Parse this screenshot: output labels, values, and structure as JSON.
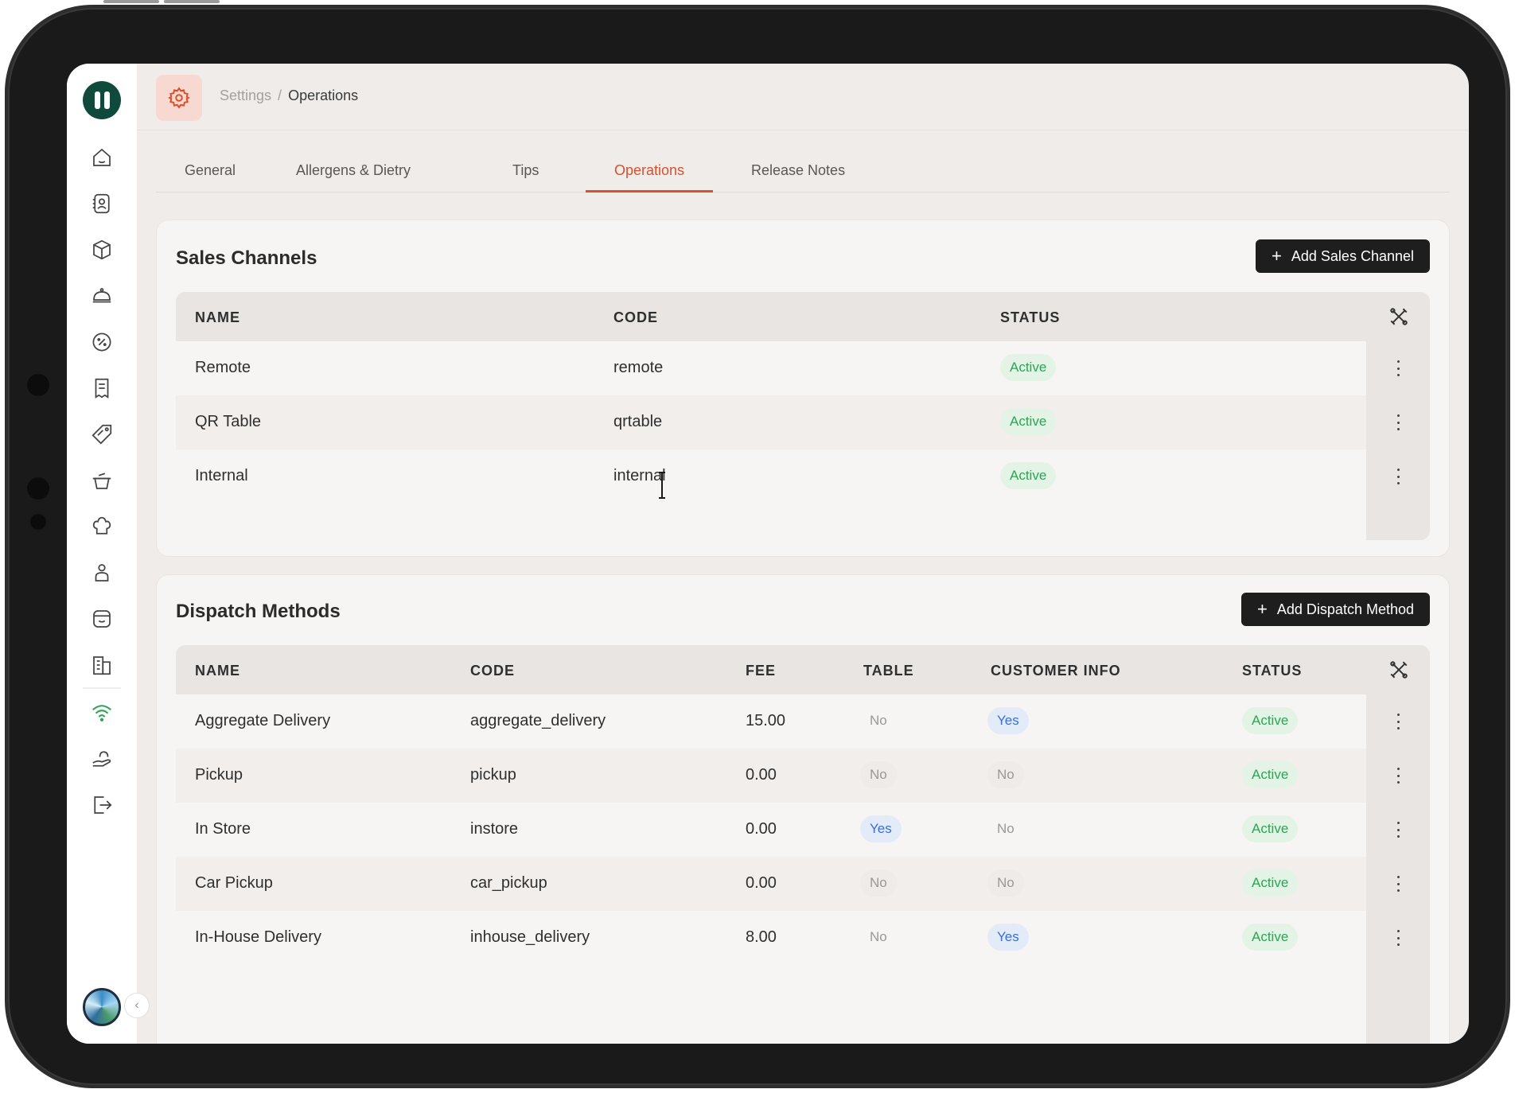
{
  "breadcrumb": {
    "root": "Settings",
    "separator": "/",
    "current": "Operations"
  },
  "tabs": [
    {
      "label": "General"
    },
    {
      "label": "Allergens & Dietry"
    },
    {
      "label": "Tips"
    },
    {
      "label": "Operations",
      "active": true
    },
    {
      "label": "Release Notes"
    }
  ],
  "sales_channels": {
    "title": "Sales Channels",
    "add_label": "Add Sales Channel",
    "columns": [
      "NAME",
      "CODE",
      "STATUS"
    ],
    "rows": [
      {
        "name": "Remote",
        "code": "remote",
        "status": "Active"
      },
      {
        "name": "QR Table",
        "code": "qrtable",
        "status": "Active"
      },
      {
        "name": "Internal",
        "code": "internal",
        "status": "Active"
      }
    ]
  },
  "dispatch_methods": {
    "title": "Dispatch Methods",
    "add_label": "Add Dispatch Method",
    "columns": [
      "NAME",
      "CODE",
      "FEE",
      "TABLE",
      "CUSTOMER INFO",
      "STATUS"
    ],
    "rows": [
      {
        "name": "Aggregate Delivery",
        "code": "aggregate_delivery",
        "fee": "15.00",
        "table": "No",
        "customer_info": "Yes",
        "status": "Active"
      },
      {
        "name": "Pickup",
        "code": "pickup",
        "fee": "0.00",
        "table": "No",
        "customer_info": "No",
        "status": "Active"
      },
      {
        "name": "In Store",
        "code": "instore",
        "fee": "0.00",
        "table": "Yes",
        "customer_info": "No",
        "status": "Active"
      },
      {
        "name": "Car Pickup",
        "code": "car_pickup",
        "fee": "0.00",
        "table": "No",
        "customer_info": "No",
        "status": "Active"
      },
      {
        "name": "In-House Delivery",
        "code": "inhouse_delivery",
        "fee": "8.00",
        "table": "No",
        "customer_info": "Yes",
        "status": "Active"
      }
    ]
  },
  "sidebar": {
    "icons": [
      "home-icon",
      "contacts-icon",
      "box-icon",
      "cloche-icon",
      "discount-icon",
      "receipt-icon",
      "tag-icon",
      "cooking-pot-icon",
      "chef-hat-icon",
      "user-icon",
      "store-icon",
      "building-icon",
      "wifi-icon",
      "hand-icon",
      "logout-icon"
    ]
  },
  "colors": {
    "accent": "#d9512c",
    "brand": "#0f4a3c",
    "active_green": "#2aa653",
    "yes_blue": "#3b6fd4"
  }
}
